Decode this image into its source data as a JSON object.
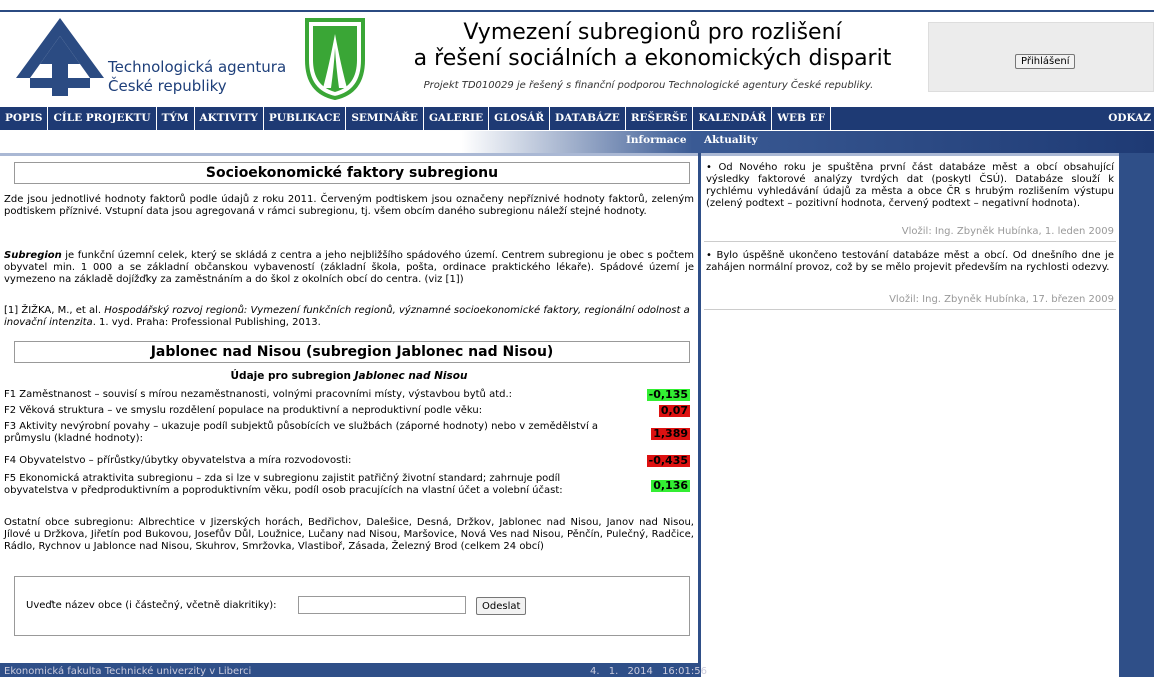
{
  "header": {
    "agency_name_line1": "Technologická agentura",
    "agency_name_line2": "České republiky",
    "title_line1": "Vymezení subregionů pro rozlišení",
    "title_line2": "a řešení sociálních a ekonomických disparit",
    "subtitle": "Projekt TD010029 je řešený s finanční podporou Technologické agentury České republiky.",
    "login_label": "Přihlášení"
  },
  "nav": {
    "items": [
      "POPIS",
      "CÍLE PROJEKTU",
      "TÝM",
      "AKTIVITY",
      "PUBLIKACE",
      "SEMINÁŘE",
      "GALERIE",
      "GLOSÁŘ",
      "DATABÁZE",
      "REŠERŠE",
      "KALENDÁŘ",
      "WEB EF"
    ],
    "last_item": "ODKAZ"
  },
  "subnav": {
    "info": "Informace",
    "news": "Aktuality"
  },
  "main": {
    "section_heading": "Socioekonomické faktory subregionu",
    "intro": "Zde jsou jednotlivé hodnoty faktorů podle údajů z roku 2011. Červeným podtiskem jsou označeny nepříznivé hodnoty faktorů, zeleným podtiskem příznivé. Vstupní data jsou agregovaná v rámci subregionu, tj. všem obcím daného subregionu náleží stejné hodnoty.",
    "subregion_term": "Subregion",
    "subregion_def": " je funkční územní celek, který se skládá z centra a jeho nejbližšího spádového území. Centrem subregionu je obec s počtem obyvatel min. 1 000 a se základní občanskou vybaveností (základní škola, pošta, ordinace praktického lékaře). Spádové území je vymezeno na základě dojížďky za zaměstnáním a do škol z okolních obcí do centra. (viz [1])",
    "reference_prefix": "[1] ŽIŽKA, M., et al. ",
    "reference_title": "Hospodářský rozvoj regionů: Vymezení funkčních regionů, významné socioekonomické faktory, regionální odolnost a inovační intenzita",
    "reference_suffix": ". 1. vyd. Praha: Professional Publishing, 2013.",
    "region_heading": "Jablonec nad Nisou (subregion Jablonec nad Nisou)",
    "data_title_prefix": "Údaje pro subregion ",
    "data_title_region": "Jablonec nad Nisou",
    "factors": [
      {
        "text": "F1 Zaměstnanost – souvisí s mírou nezaměstnanosti, volnými pracovními místy, výstavbou bytů atd.:",
        "value": "-0,135",
        "status": "positive"
      },
      {
        "text": "F2 Věková struktura – ve smyslu rozdělení populace na produktivní a neproduktivní podle věku:",
        "value": "0,07",
        "status": "negative"
      },
      {
        "text": "F3 Aktivity nevýrobní povahy – ukazuje podíl subjektů působících ve službách (záporné hodnoty) nebo v zemědělství a průmyslu (kladné hodnoty):",
        "value": "1,389",
        "status": "negative"
      },
      {
        "text": "F4 Obyvatelstvo – přírůstky/úbytky obyvatelstva a míra rozvodovosti:",
        "value": "-0,435",
        "status": "negative"
      },
      {
        "text": "F5 Ekonomická atraktivita subregionu – zda si lze v subregionu zajistit patřičný životní standard; zahrnuje podíl obyvatelstva v předproduktivním a poproduktivním věku, podíl osob pracujících na vlastní účet a volební účast:",
        "value": "0,136",
        "status": "positive"
      }
    ],
    "other_municipalities": "Ostatní obce subregionu: Albrechtice v Jizerských horách, Bedřichov, Dalešice, Desná, Držkov, Jablonec nad Nisou, Janov nad Nisou, Jílové u Držkova, Jiřetín pod Bukovou, Josefův Důl, Loužnice, Lučany nad Nisou, Maršovice, Nová Ves nad Nisou, Pěnčín, Pulečný, Radčice, Rádlo, Rychnov u Jablonce nad Nisou, Skuhrov, Smržovka, Vlastiboř, Zásada, Železný Brod (celkem 24 obcí)",
    "search_label": "Uveďte název obce (i částečný, včetně diakritiky):",
    "search_value": "",
    "search_button": "Odeslat"
  },
  "news": [
    {
      "text": "• Od Nového roku je spuštěna první část databáze měst a obcí obsahující výsledky faktorové analýzy tvrdých dat (poskytl ČSÚ). Databáze slouží k rychlému vyhledávání údajů za města a obce ČR s hrubým rozlišením výstupu (zelený podtext – pozitivní hodnota, červený podtext – negativní hodnota).",
      "signature": "Vložil: Ing. Zbyněk Hubínka, 1. leden 2009"
    },
    {
      "text": "• Bylo úspěšně ukončeno testování databáze měst a obcí. Od dnešního dne je zahájen normální provoz, což by se mělo projevit především na rychlosti odezvy.",
      "signature": "Vložil: Ing. Zbyněk Hubínka, 17. březen 2009"
    }
  ],
  "footer": {
    "left": "Ekonomická fakulta Technické univerzity v Liberci",
    "right": "4. 1. 2014 16:01:56"
  },
  "colors": {
    "nav_bg": "#1e3a74",
    "positive": "#33ee33",
    "negative": "#dd1111",
    "brand_blue": "#1e3f7a",
    "logo_green": "#3aa636"
  }
}
